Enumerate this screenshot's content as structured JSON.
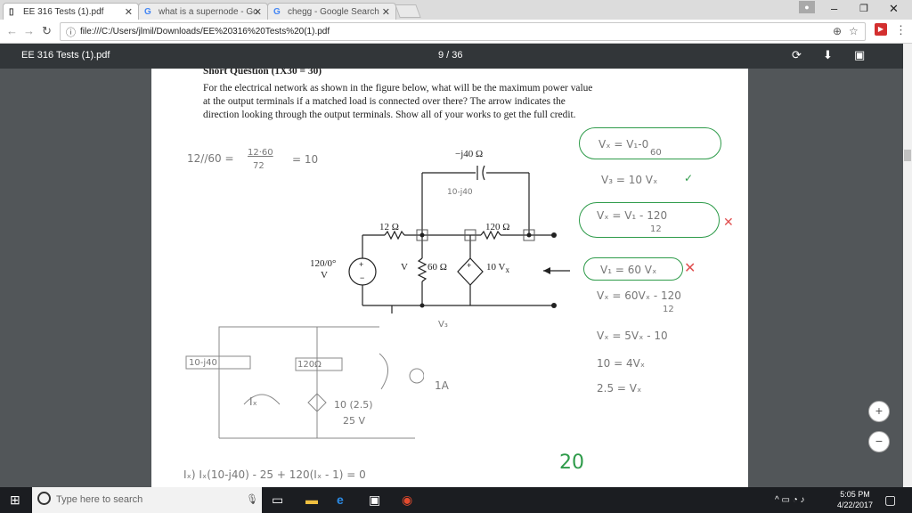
{
  "tabs": [
    {
      "label": "EE 316 Tests (1).pdf",
      "icon": "document-icon"
    },
    {
      "label": "what is a supernode - Go",
      "icon": "google-icon"
    },
    {
      "label": "chegg - Google Search",
      "icon": "google-icon"
    }
  ],
  "window": {
    "minimize": "–",
    "restore": "❐",
    "close": "✕"
  },
  "address": {
    "url": "file:///C:/Users/jlmil/Downloads/EE%20316%20Tests%20(1).pdf"
  },
  "pdf": {
    "title": "EE 316 Tests (1).pdf",
    "page_label": "9 / 36"
  },
  "document": {
    "heading_partial": "Short Question (1X30 = 30)",
    "question_lines": [
      "For the electrical network as shown in the figure below, what will be the maximum power value",
      "at the output terminals if a matched load is connected over there? The arrow indicates the",
      "direction looking through the output terminals. Show all of your works to get the full credit."
    ],
    "circuit_labels": {
      "cap": "−j40 Ω",
      "r12": "12 Ω",
      "r120": "120 Ω",
      "r60": "60 Ω",
      "source": "120/0°",
      "source_unit": "V",
      "v1": "V",
      "dep": "10 V",
      "dep_sub": "x"
    },
    "handwriting": {
      "calc1": "12//60 =",
      "calc1b": "12·60",
      "calc1c": "72",
      "calc1d": "= 10",
      "cap_note": "10-j40",
      "nodes": "V₁  Vₓ  V₃  VA",
      "vs_label": "V₃",
      "mesh_box1": "10-j40",
      "mesh_box2": "120Ω",
      "ix_label": "Iₓ",
      "dep_val": "10 (2.5)",
      "dep_val2": "25 V",
      "one_a": "1A",
      "bottom_eq": "Iₓ)  Iₓ(10-j40) - 25 + 120(Iₓ - 1) = 0",
      "right1": "Vₓ = V₁-0",
      "right1b": "60",
      "right2": "V₃ = 10 Vₓ",
      "right3": "Vₓ = V₁ - 120",
      "right3b": "12",
      "right4": "V₁ = 60 Vₓ",
      "right5": "Vₓ = 60Vₓ - 120",
      "right5b": "12",
      "right6": "Vₓ = 5Vₓ - 10",
      "right7": "10 = 4Vₓ",
      "right8": "2.5 = Vₓ",
      "score": "20"
    }
  },
  "zoom": {
    "in": "+",
    "out": "−"
  },
  "taskbar": {
    "search_placeholder": "Type here to search",
    "time": "5:05 PM",
    "date": "4/22/2017"
  }
}
